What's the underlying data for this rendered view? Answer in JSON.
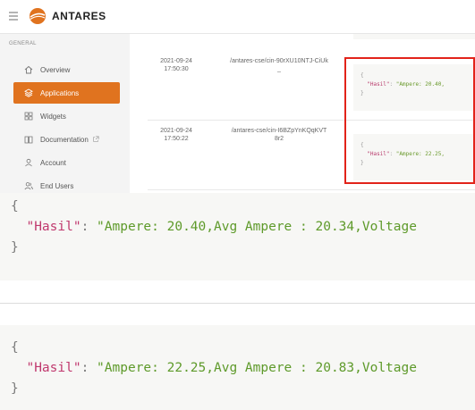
{
  "app": {
    "brand": "ANTARES"
  },
  "sidebar": {
    "heading": "GENERAL",
    "items": [
      {
        "label": "Overview",
        "icon": "home-icon",
        "active": false
      },
      {
        "label": "Applications",
        "icon": "layers-icon",
        "active": true
      },
      {
        "label": "Widgets",
        "icon": "grid-icon",
        "active": false
      },
      {
        "label": "Documentation",
        "icon": "book-icon",
        "active": false
      },
      {
        "label": "Account",
        "icon": "user-icon",
        "active": false
      },
      {
        "label": "End Users",
        "icon": "users-icon",
        "active": false
      }
    ]
  },
  "records": [
    {
      "date": "2021-09-24",
      "time": "17:50:30",
      "path": "/antares-cse/cin-90rXU10NTJ-CiUk_",
      "json_open": "{",
      "json_key": "\"Hasil\"",
      "json_colon": ": ",
      "json_value_short": "\"Ampere: 20.40,",
      "json_close": "}"
    },
    {
      "date": "2021-09-24",
      "time": "17:50:22",
      "path": "/antares-cse/cin-I6BZpYnKQqKVT8r2",
      "json_open": "{",
      "json_key": "\"Hasil\"",
      "json_colon": ": ",
      "json_value_short": "\"Ampere: 22.25,",
      "json_close": "}"
    }
  ],
  "zoomed": [
    {
      "open": "{",
      "key": "\"Hasil\"",
      "colon": ": ",
      "value": "\"Ampere: 20.40,Avg Ampere : 20.34,Voltage",
      "close": "}"
    },
    {
      "open": "{",
      "key": "\"Hasil\"",
      "colon": ": ",
      "value": "\"Ampere: 22.25,Avg Ampere : 20.83,Voltage",
      "close": "}"
    }
  ],
  "colors": {
    "accent": "#e0731f",
    "highlight": "#e2231a",
    "json_key": "#c0396e",
    "json_value": "#5e9a2a"
  }
}
